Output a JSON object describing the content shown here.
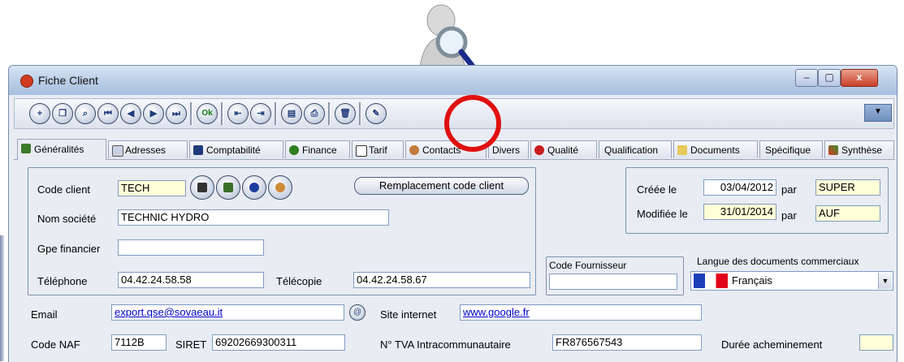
{
  "window": {
    "title": "Fiche Client",
    "controls": {
      "minimize": "–",
      "maximize": "▢",
      "close": "x"
    }
  },
  "toolbar": {
    "more_label": "▼",
    "ok_label": "Ok"
  },
  "tabs": [
    {
      "label": "Généralités"
    },
    {
      "label": "Adresses"
    },
    {
      "label": "Comptabilité"
    },
    {
      "label": "Finance"
    },
    {
      "label": "Tarif"
    },
    {
      "label": "Contacts"
    },
    {
      "label": "Divers"
    },
    {
      "label": "Qualité"
    },
    {
      "label": "Qualification"
    },
    {
      "label": "Documents"
    },
    {
      "label": "Spécifique"
    },
    {
      "label": "Synthèse"
    }
  ],
  "client": {
    "code_label": "Code client",
    "code": "TECH",
    "nom_label": "Nom société",
    "nom": "TECHNIC HYDRO",
    "gpe_label": "Gpe financier",
    "gpe": "",
    "tel_label": "Téléphone",
    "tel": "04.42.24.58.58",
    "fax_label": "Télécopie",
    "fax": "04.42.24.58.67",
    "replace_button": "Remplacement code client"
  },
  "audit": {
    "creee_label": "Créée le",
    "creee_date": "03/04/2012",
    "par1_label": "par",
    "creee_par": "SUPER",
    "modifiee_label": "Modifiée le",
    "modifiee_date": "31/01/2014",
    "par2_label": "par",
    "modifiee_par": "AUF"
  },
  "fournisseur": {
    "label": "Code Fournisseur",
    "value": ""
  },
  "langue": {
    "label": "Langue  des documents commerciaux",
    "value": "Français"
  },
  "contact": {
    "email_label": "Email",
    "email": "export.qse@sovaeau.it",
    "site_label": "Site internet",
    "site": "www.google.fr",
    "naf_label": "Code NAF",
    "naf": "7112B",
    "siret_label": "SIRET",
    "siret": "69202669300311",
    "tva_label": "N° TVA  Intracommunautaire",
    "tva": "FR876567543",
    "duree_label": "Durée acheminement",
    "duree": ""
  }
}
